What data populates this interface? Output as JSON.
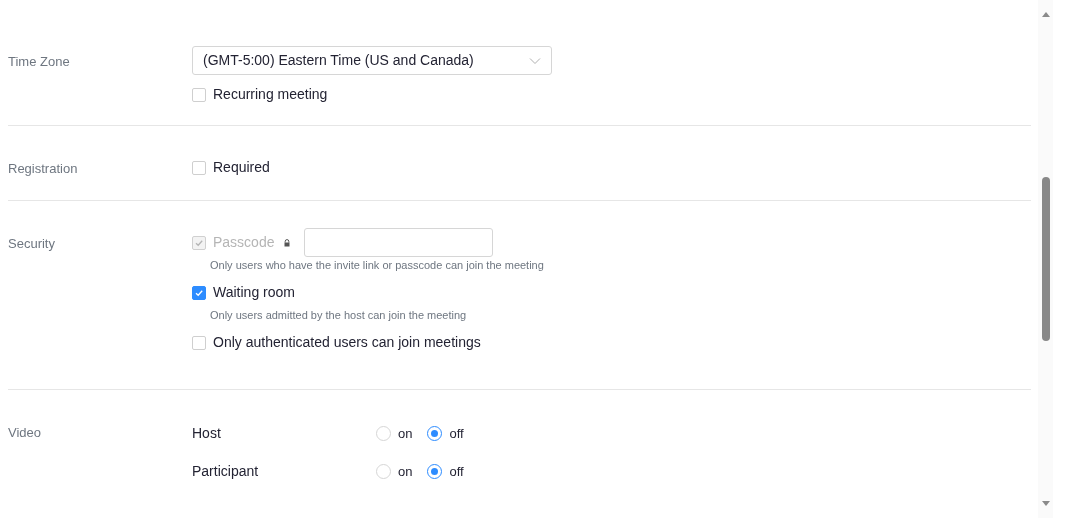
{
  "sections": [
    {
      "label": "Time Zone",
      "items": [
        {
          "kind": "select",
          "value": "(GMT-5:00) Eastern Time (US and Canada)"
        },
        {
          "kind": "checkbox",
          "label": "Recurring meeting",
          "checked": false,
          "disabled": false
        }
      ]
    },
    {
      "label": "Registration",
      "items": [
        {
          "kind": "checkbox",
          "label": "Required",
          "checked": false,
          "disabled": false
        }
      ]
    },
    {
      "label": "Security",
      "items": [
        {
          "kind": "checkbox",
          "label": "Passcode",
          "checked": true,
          "disabled": true,
          "lock": true,
          "input": true,
          "hint": "Only users who have the invite link or passcode can join the meeting"
        },
        {
          "kind": "checkbox",
          "label": "Waiting room",
          "checked": true,
          "disabled": false,
          "hint": "Only users admitted by the host can join the meeting"
        },
        {
          "kind": "checkbox",
          "label": "Only authenticated users can join meetings",
          "checked": false,
          "disabled": false
        }
      ]
    },
    {
      "label": "Video",
      "items": [
        {
          "kind": "radio",
          "label": "Host",
          "options": [
            {
              "label": "on",
              "selected": false
            },
            {
              "label": "off",
              "selected": true
            }
          ]
        },
        {
          "kind": "radio",
          "label": "Participant",
          "options": [
            {
              "label": "on",
              "selected": false
            },
            {
              "label": "off",
              "selected": true
            }
          ]
        }
      ]
    }
  ]
}
